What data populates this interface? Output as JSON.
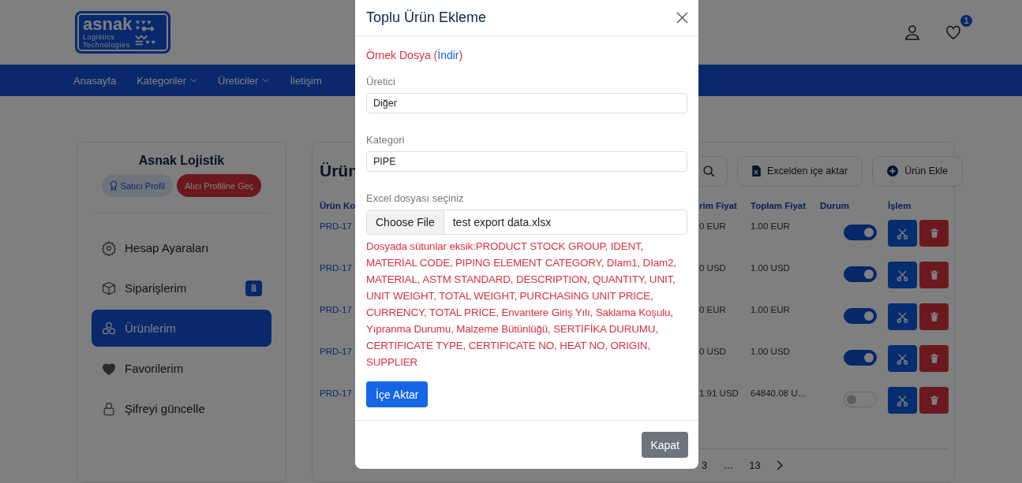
{
  "header": {
    "logo": {
      "wordmark": "asnak",
      "line_2": "Logistics",
      "line_3": "Technologies"
    },
    "wishlist_count": "1"
  },
  "nav": {
    "items": [
      {
        "label": "Anasayfa",
        "dropdown": false
      },
      {
        "label": "Kategoriler",
        "dropdown": true
      },
      {
        "label": "Üreticiler",
        "dropdown": true
      },
      {
        "label": "İletişim",
        "dropdown": false
      }
    ]
  },
  "sidebar": {
    "title": "Asnak Lojistik",
    "buttons": [
      {
        "label": "Satıcı Profil",
        "kind": "secondary"
      },
      {
        "label": "Alıcı Profiline Geç",
        "kind": "danger"
      }
    ],
    "items": [
      {
        "label": "Hesap Ayaraları",
        "selected": false
      },
      {
        "label": "Siparişlerim",
        "selected": false,
        "badge": "8"
      },
      {
        "label": "Ürünlerim",
        "selected": true
      },
      {
        "label": "Favorilerim",
        "selected": false
      },
      {
        "label": "Şifreyi güncelle",
        "selected": false
      }
    ]
  },
  "content": {
    "title": "Ürün",
    "toolbar": [
      "Excelden içe aktar",
      "Ürün Ekle"
    ],
    "table": {
      "columns": [
        "Ürün Ko",
        "rim Fiyat",
        "Toplam Fiyat",
        "Durum",
        "İşlem"
      ],
      "rows": [
        {
          "code": "PRD-17",
          "unit_price": "0 EUR",
          "total_price": "1.00 EUR",
          "on": true
        },
        {
          "code": "PRD-17",
          "unit_price": "0 USD",
          "total_price": "1.00 USD",
          "on": true
        },
        {
          "code": "PRD-17",
          "unit_price": "0 EUR",
          "total_price": "1.00 EUR",
          "on": true
        },
        {
          "code": "PRD-17",
          "unit_price": "0 USD",
          "total_price": "1.00 USD",
          "on": true
        },
        {
          "code": "PRD-17",
          "unit_price": "1.91 USD",
          "total_price": "64840.08 U…",
          "on": false
        }
      ]
    },
    "pagination": [
      "3",
      "…",
      "13"
    ]
  },
  "modal": {
    "title": "Toplu Ürün Ekleme",
    "sample": {
      "prefix": "Örnek Dosya (",
      "link": "İndir",
      "suffix": ")"
    },
    "fields": [
      {
        "label": "Üretici",
        "value": "Diğer"
      },
      {
        "label": "Kategori",
        "value": "PIPE"
      }
    ],
    "file": {
      "label": "Excel dosyası seçiniz",
      "button": "Choose File",
      "value": "test export data.xlsx"
    },
    "error": "Dosyada sütunlar eksik:PRODUCT STOCK GROUP, IDENT, MATERİAL CODE, PIPING ELEMENT CATEGORY, DIam1, DIam2, MATERIAL, ASTM STANDARD, DESCRIPTION, QUANTITY, UNIT, UNIT WEIGHT, TOTAL WEIGHT, PURCHASING UNIT PRICE, CURRENCY, TOTAL PRICE, Envantere Giriş Yılı, Saklama Koşulu, Yıpranma Durumu, Malzeme Bütünlüğü, SERTİFİKA DURUMU, CERTIFICATE TYPE, CERTIFICATE NO, HEAT NO, ORIGIN, SUPPLIER",
    "import_button": "İçe Aktar",
    "close_button": "Kapat"
  }
}
